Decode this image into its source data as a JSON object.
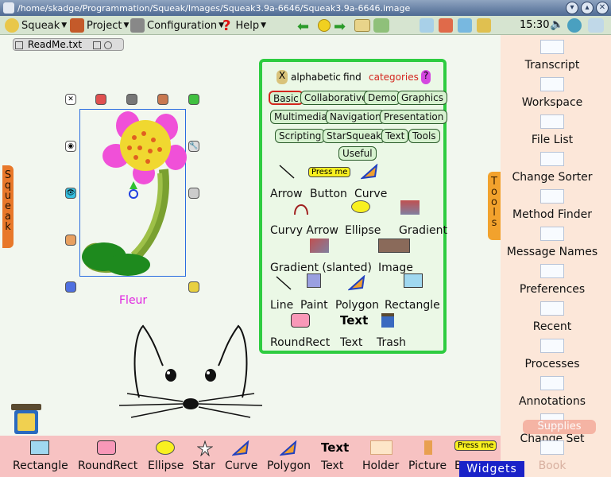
{
  "titlebar": {
    "path": "/home/skadge/Programmation/Squeak/Images/Squeak3.9a-6646/Squeak3.9a-6646.image"
  },
  "menubar": {
    "squeak": "Squeak",
    "project": "Project",
    "configuration": "Configuration",
    "help": "Help",
    "clock": "15:30"
  },
  "readme": {
    "title": "ReadMe.txt"
  },
  "flaps": {
    "squeak": "Squeak",
    "tools": "Tools",
    "supplies": "Supplies",
    "widgets": "Widgets"
  },
  "morph": {
    "name": "Fleur"
  },
  "objects": {
    "tabs": {
      "alphabetic": "alphabetic",
      "find": "find",
      "categories": "categories",
      "close": "X",
      "help": "?"
    },
    "categories": [
      "Basic",
      "Collaborative",
      "Demo",
      "Graphics",
      "Multimedia",
      "Navigation",
      "Presentation",
      "Scripting",
      "StarSqueak",
      "Text",
      "Tools",
      "Useful"
    ],
    "parts": [
      "Arrow",
      "Button",
      "Curve",
      "Curvy Arrow",
      "Ellipse",
      "Gradient",
      "Gradient (slanted)",
      "Image",
      "Line",
      "Paint",
      "Polygon",
      "Rectangle",
      "RoundRect",
      "Text",
      "Trash"
    ],
    "button_sample": "Press me",
    "text_sample": "Text"
  },
  "tools": [
    "Transcript",
    "Workspace",
    "File List",
    "Change Sorter",
    "Method Finder",
    "Message Names",
    "Preferences",
    "Recent",
    "Processes",
    "Annotations",
    "Change Set",
    "Book"
  ],
  "supplies": [
    "Rectangle",
    "RoundRect",
    "Ellipse",
    "Star",
    "Curve",
    "Polygon",
    "Text",
    "Holder",
    "Picture",
    "B"
  ],
  "supplies_samples": {
    "text": "Text",
    "button": "Press me"
  },
  "colors": {
    "objects_border": "#2ecc40",
    "categories_selected": "#d4261e",
    "widgets": "#1a22c8",
    "fleur": "#e025e0"
  }
}
